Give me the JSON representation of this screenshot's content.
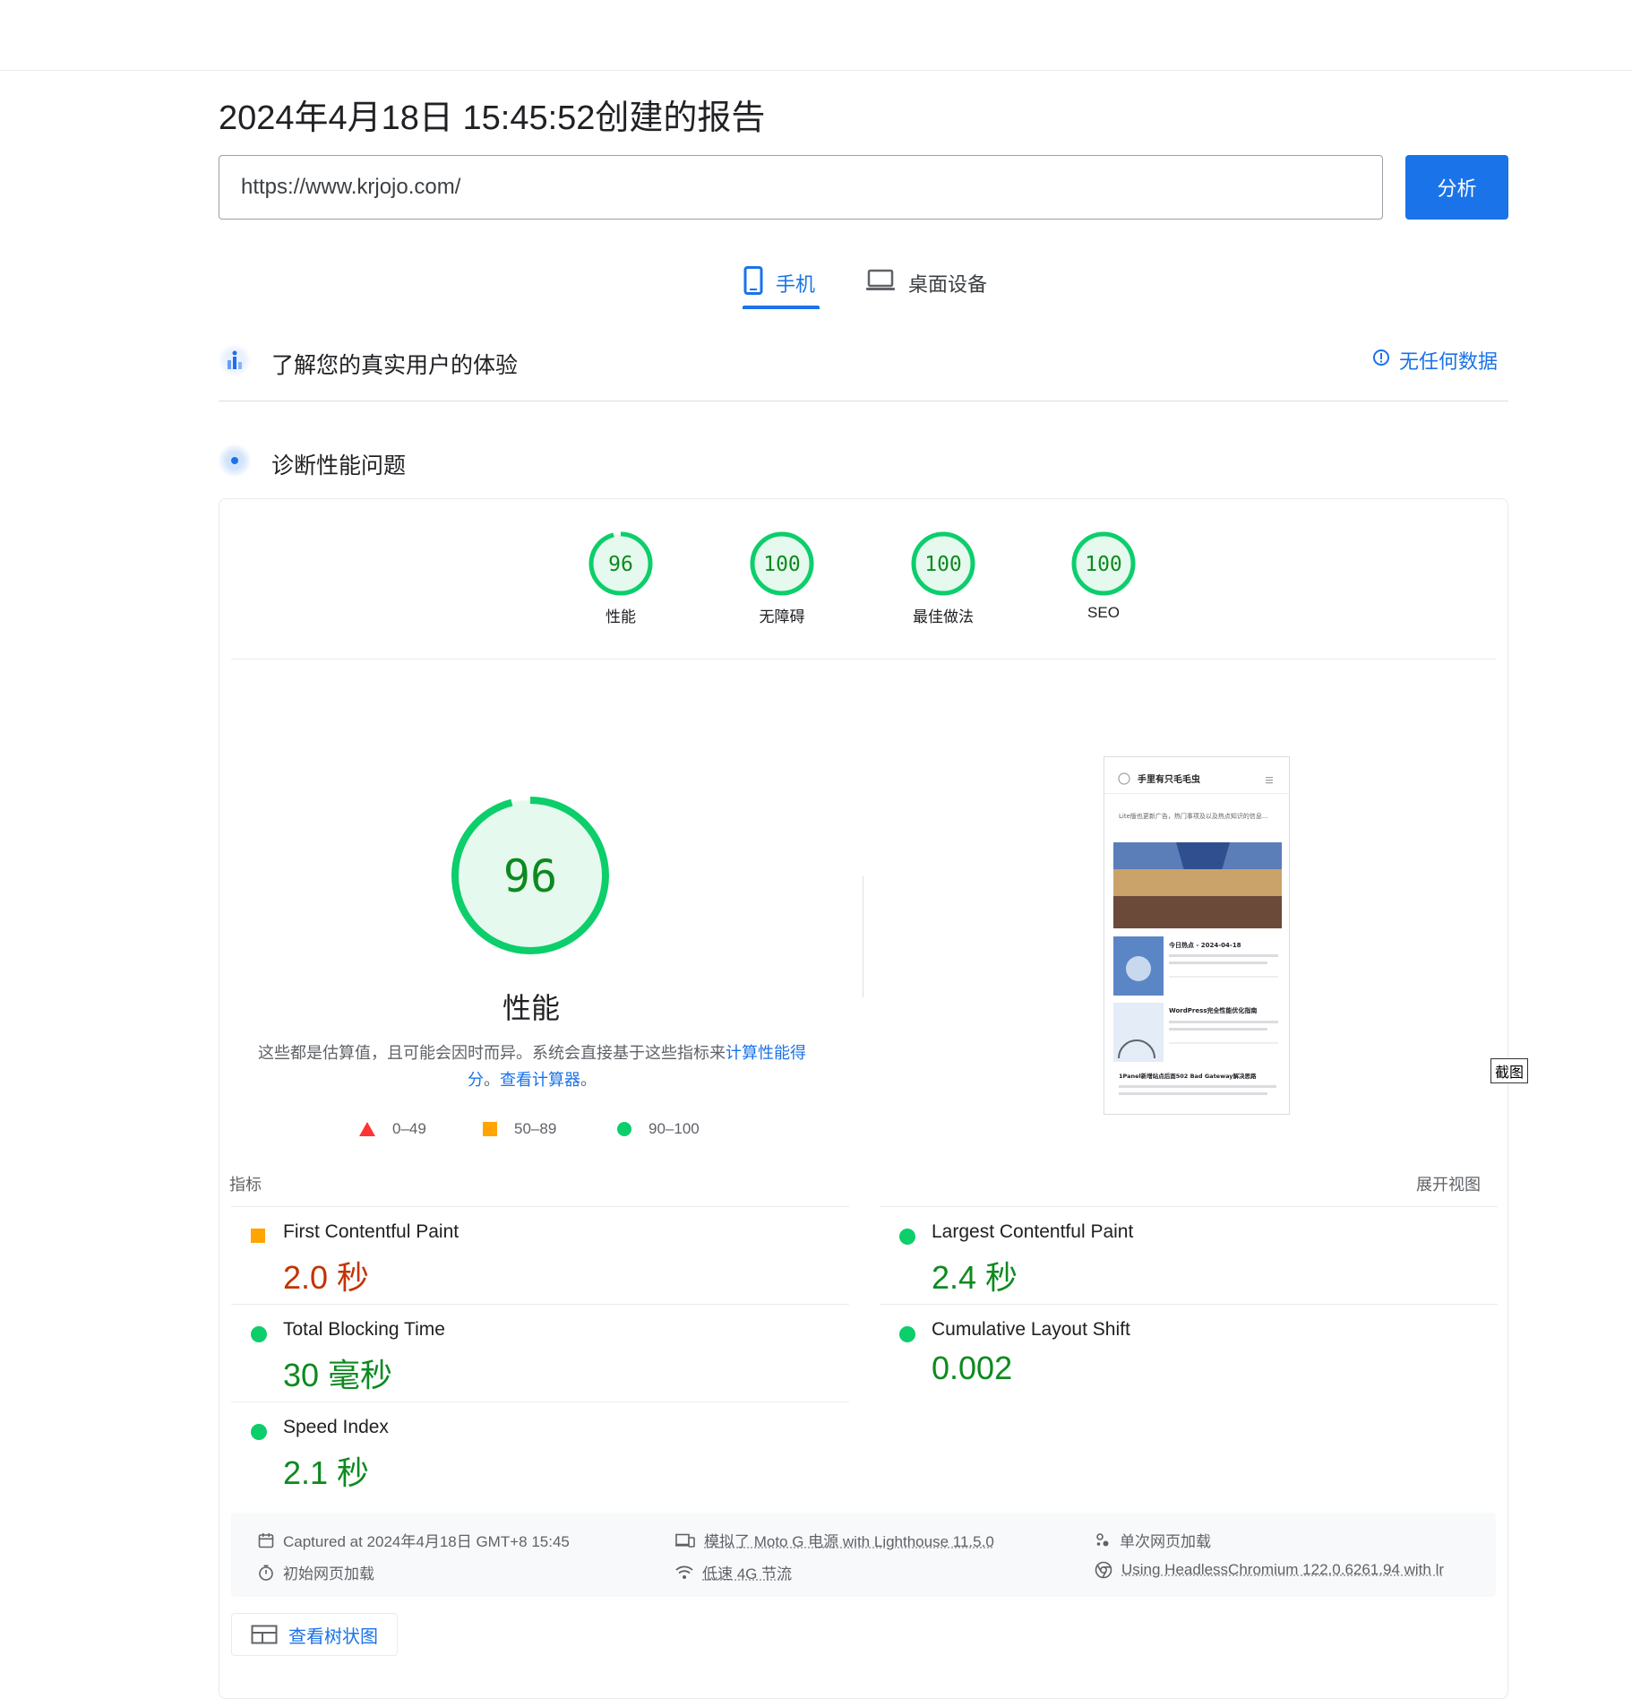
{
  "report_title": "2024年4月18日 15:45:52创建的报告",
  "url_value": "https://www.krjojo.com/",
  "analyze_label": "分析",
  "tabs": [
    {
      "label": "手机",
      "active": true
    },
    {
      "label": "桌面设备",
      "active": false
    }
  ],
  "field_data": {
    "title": "了解您的真实用户的体验",
    "no_data_label": "无任何数据"
  },
  "diagnose": {
    "title": "诊断性能问题"
  },
  "categories": [
    {
      "score": "96",
      "label": "性能"
    },
    {
      "score": "100",
      "label": "无障碍"
    },
    {
      "score": "100",
      "label": "最佳做法"
    },
    {
      "score": "100",
      "label": "SEO"
    }
  ],
  "performance": {
    "score": "96",
    "label": "性能",
    "desc_prefix": "这些都是估算值，且可能会因时而异。系统会直接基于这些指标来",
    "desc_link1": "计算性能得分",
    "desc_mid": "。",
    "desc_link2": "查看计算器",
    "desc_suffix": "。"
  },
  "legend": [
    {
      "range": "0–49",
      "shape": "triangle",
      "color": "#ff3333"
    },
    {
      "range": "50–89",
      "shape": "square",
      "color": "#ffa400"
    },
    {
      "range": "90–100",
      "shape": "circle",
      "color": "#0cce6b"
    }
  ],
  "screenshot": {
    "site_name": "手里有只毛毛虫",
    "notice": "Lite版也更新广告，热门事项及以及热点知识的信息…",
    "post1_title": "今日热点 - 2024-04-18",
    "post2_title": "WordPress完全性能优化指南",
    "post3_title": "1Panel新增站点后面502 Bad Gateway解决思路",
    "tag": "截图"
  },
  "metrics_header": "指标",
  "expand_label": "展开视图",
  "metrics": [
    {
      "name": "First Contentful Paint",
      "value": "2.0 秒",
      "status": "average"
    },
    {
      "name": "Largest Contentful Paint",
      "value": "2.4 秒",
      "status": "pass"
    },
    {
      "name": "Total Blocking Time",
      "value": "30 毫秒",
      "status": "pass"
    },
    {
      "name": "Cumulative Layout Shift",
      "value": "0.002",
      "status": "pass"
    },
    {
      "name": "Speed Index",
      "value": "2.1 秒",
      "status": "pass"
    }
  ],
  "run_info": {
    "captured": "Captured at 2024年4月18日 GMT+8 15:45",
    "initial_load": "初始网页加载",
    "emulated": "模拟了 Moto G 电源 with Lighthouse 11.5.0",
    "throttling": "低速 4G 节流",
    "single_load": "单次网页加载",
    "browser": "Using HeadlessChromium 122.0.6261.94 with lr"
  },
  "treemap_label": "查看树状图",
  "colors": {
    "accent": "#1a73e8",
    "pass": "#0cce6b",
    "pass_text": "#0d8a1f",
    "average": "#ffa400",
    "average_text": "#c33300",
    "fail": "#ff3333"
  }
}
